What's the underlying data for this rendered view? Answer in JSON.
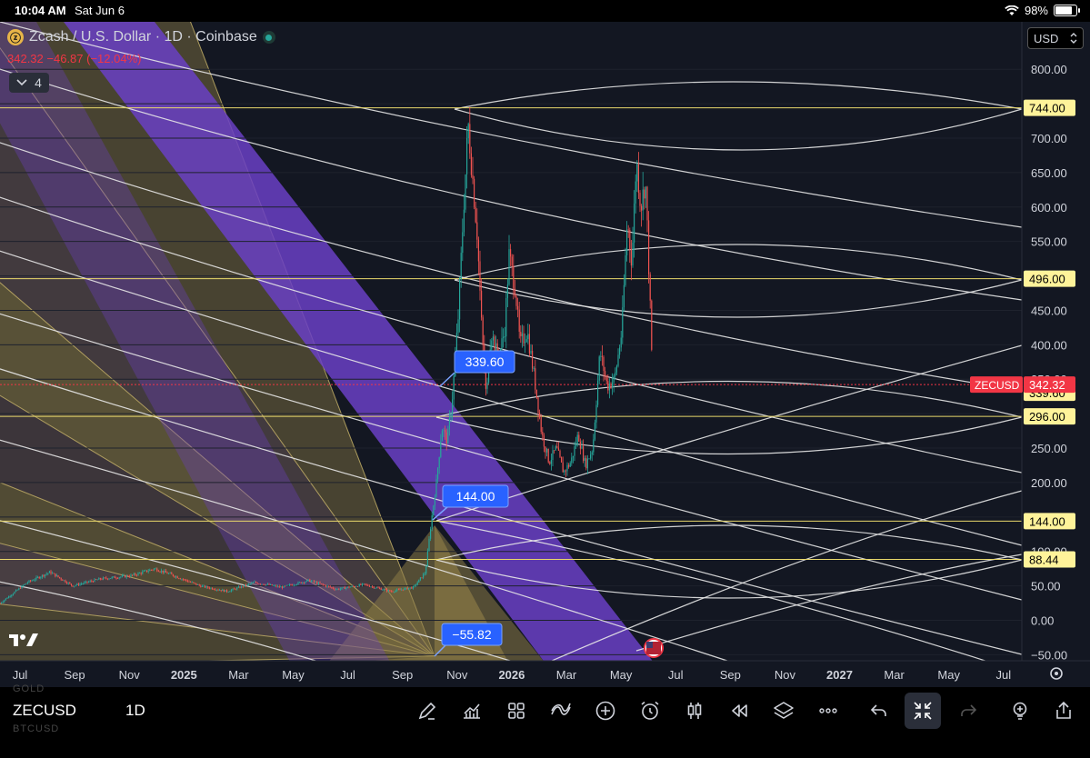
{
  "status_bar": {
    "time": "10:04 AM",
    "date": "Sat Jun 6",
    "battery": "98%"
  },
  "legend": {
    "title": "Zcash / U.S. Dollar · 1D · Coinbase",
    "price": "342.32",
    "change": "−46.87 (−12.04%)",
    "collapse_count": "4"
  },
  "currency": "USD",
  "bottom": {
    "symbol": "ZECUSD",
    "interval": "1D",
    "ghost_top": "GOLD",
    "ghost_bottom": "BTCUSD"
  },
  "colors": {
    "bg": "#131722",
    "up": "#26a69a",
    "down": "#ef5350",
    "hline": "#e9d86b",
    "label_bg": "#fff39a",
    "band": "#6a3fc4",
    "last": "#f23645",
    "callout": "#2962ff"
  },
  "icons": [
    "pencil-icon",
    "chart-icon",
    "grid-icon",
    "indicator-icon",
    "plus-icon",
    "alarm-icon",
    "candle-icon",
    "replay-icon",
    "layers-icon",
    "more-icon",
    "undo-icon",
    "compress-icon",
    "redo-icon",
    "bulb-icon",
    "share-icon"
  ],
  "chart_data": {
    "type": "candlestick",
    "symbol": "ZECUSD",
    "ylim": [
      -50,
      850
    ],
    "y_ticks": [
      -50,
      0,
      50,
      100,
      150,
      200,
      250,
      300,
      350,
      400,
      450,
      500,
      550,
      600,
      650,
      700,
      750,
      800
    ],
    "y_tick_labels": [
      "−50.00",
      "0.00",
      "50.00",
      "100.00",
      "150.00",
      "200.00",
      "250.00",
      "300.00",
      "350.00",
      "400.00",
      "450.00",
      "500.00",
      "550.00",
      "600.00",
      "650.00",
      "700.00",
      "750.00",
      "800.00"
    ],
    "x_ticks": [
      "Jul",
      "Sep",
      "Nov",
      "2025",
      "Mar",
      "May",
      "Jul",
      "Sep",
      "Nov",
      "2026",
      "Mar",
      "May",
      "Jul",
      "Sep",
      "Nov",
      "2027",
      "Mar",
      "May",
      "Jul"
    ],
    "horizontal_levels": [
      744.0,
      496.0,
      296.0,
      144.0,
      88.44
    ],
    "level_labels": [
      "744.00",
      "496.00",
      "296.00",
      "144.00",
      "88.44"
    ],
    "last_price": {
      "label": "ZECUSD",
      "value": 342.32,
      "text": "342.32"
    },
    "extra_marker": {
      "value": 339.6,
      "text": "339.60"
    },
    "callouts": [
      {
        "text": "339.60",
        "value": 339.6
      },
      {
        "text": "144.00",
        "value": 144.0
      },
      {
        "text": "−55.82",
        "value": -55.82
      }
    ],
    "anchors": [
      {
        "t": 0,
        "p": 25
      },
      {
        "t": 30,
        "p": 55
      },
      {
        "t": 55,
        "p": 70
      },
      {
        "t": 80,
        "p": 50
      },
      {
        "t": 110,
        "p": 60
      },
      {
        "t": 145,
        "p": 65
      },
      {
        "t": 170,
        "p": 75
      },
      {
        "t": 185,
        "p": 68
      },
      {
        "t": 220,
        "p": 50
      },
      {
        "t": 250,
        "p": 42
      },
      {
        "t": 280,
        "p": 55
      },
      {
        "t": 310,
        "p": 48
      },
      {
        "t": 340,
        "p": 58
      },
      {
        "t": 370,
        "p": 45
      },
      {
        "t": 400,
        "p": 52
      },
      {
        "t": 430,
        "p": 42
      },
      {
        "t": 455,
        "p": 48
      },
      {
        "t": 468,
        "p": 70
      },
      {
        "t": 474,
        "p": 140
      },
      {
        "t": 480,
        "p": 200
      },
      {
        "t": 486,
        "p": 280
      },
      {
        "t": 492,
        "p": 260
      },
      {
        "t": 498,
        "p": 330
      },
      {
        "t": 504,
        "p": 440
      },
      {
        "t": 510,
        "p": 600
      },
      {
        "t": 515,
        "p": 720
      },
      {
        "t": 520,
        "p": 640
      },
      {
        "t": 525,
        "p": 560
      },
      {
        "t": 530,
        "p": 420
      },
      {
        "t": 535,
        "p": 320
      },
      {
        "t": 540,
        "p": 420
      },
      {
        "t": 548,
        "p": 380
      },
      {
        "t": 555,
        "p": 420
      },
      {
        "t": 560,
        "p": 530
      },
      {
        "t": 567,
        "p": 480
      },
      {
        "t": 572,
        "p": 400
      },
      {
        "t": 580,
        "p": 420
      },
      {
        "t": 588,
        "p": 350
      },
      {
        "t": 596,
        "p": 270
      },
      {
        "t": 604,
        "p": 230
      },
      {
        "t": 612,
        "p": 250
      },
      {
        "t": 620,
        "p": 215
      },
      {
        "t": 628,
        "p": 230
      },
      {
        "t": 636,
        "p": 270
      },
      {
        "t": 644,
        "p": 225
      },
      {
        "t": 652,
        "p": 250
      },
      {
        "t": 660,
        "p": 390
      },
      {
        "t": 668,
        "p": 340
      },
      {
        "t": 676,
        "p": 350
      },
      {
        "t": 684,
        "p": 420
      },
      {
        "t": 690,
        "p": 580
      },
      {
        "t": 695,
        "p": 520
      },
      {
        "t": 700,
        "p": 670
      },
      {
        "t": 705,
        "p": 600
      },
      {
        "t": 710,
        "p": 640
      },
      {
        "t": 714,
        "p": 500
      },
      {
        "t": 718,
        "p": 342
      }
    ]
  }
}
